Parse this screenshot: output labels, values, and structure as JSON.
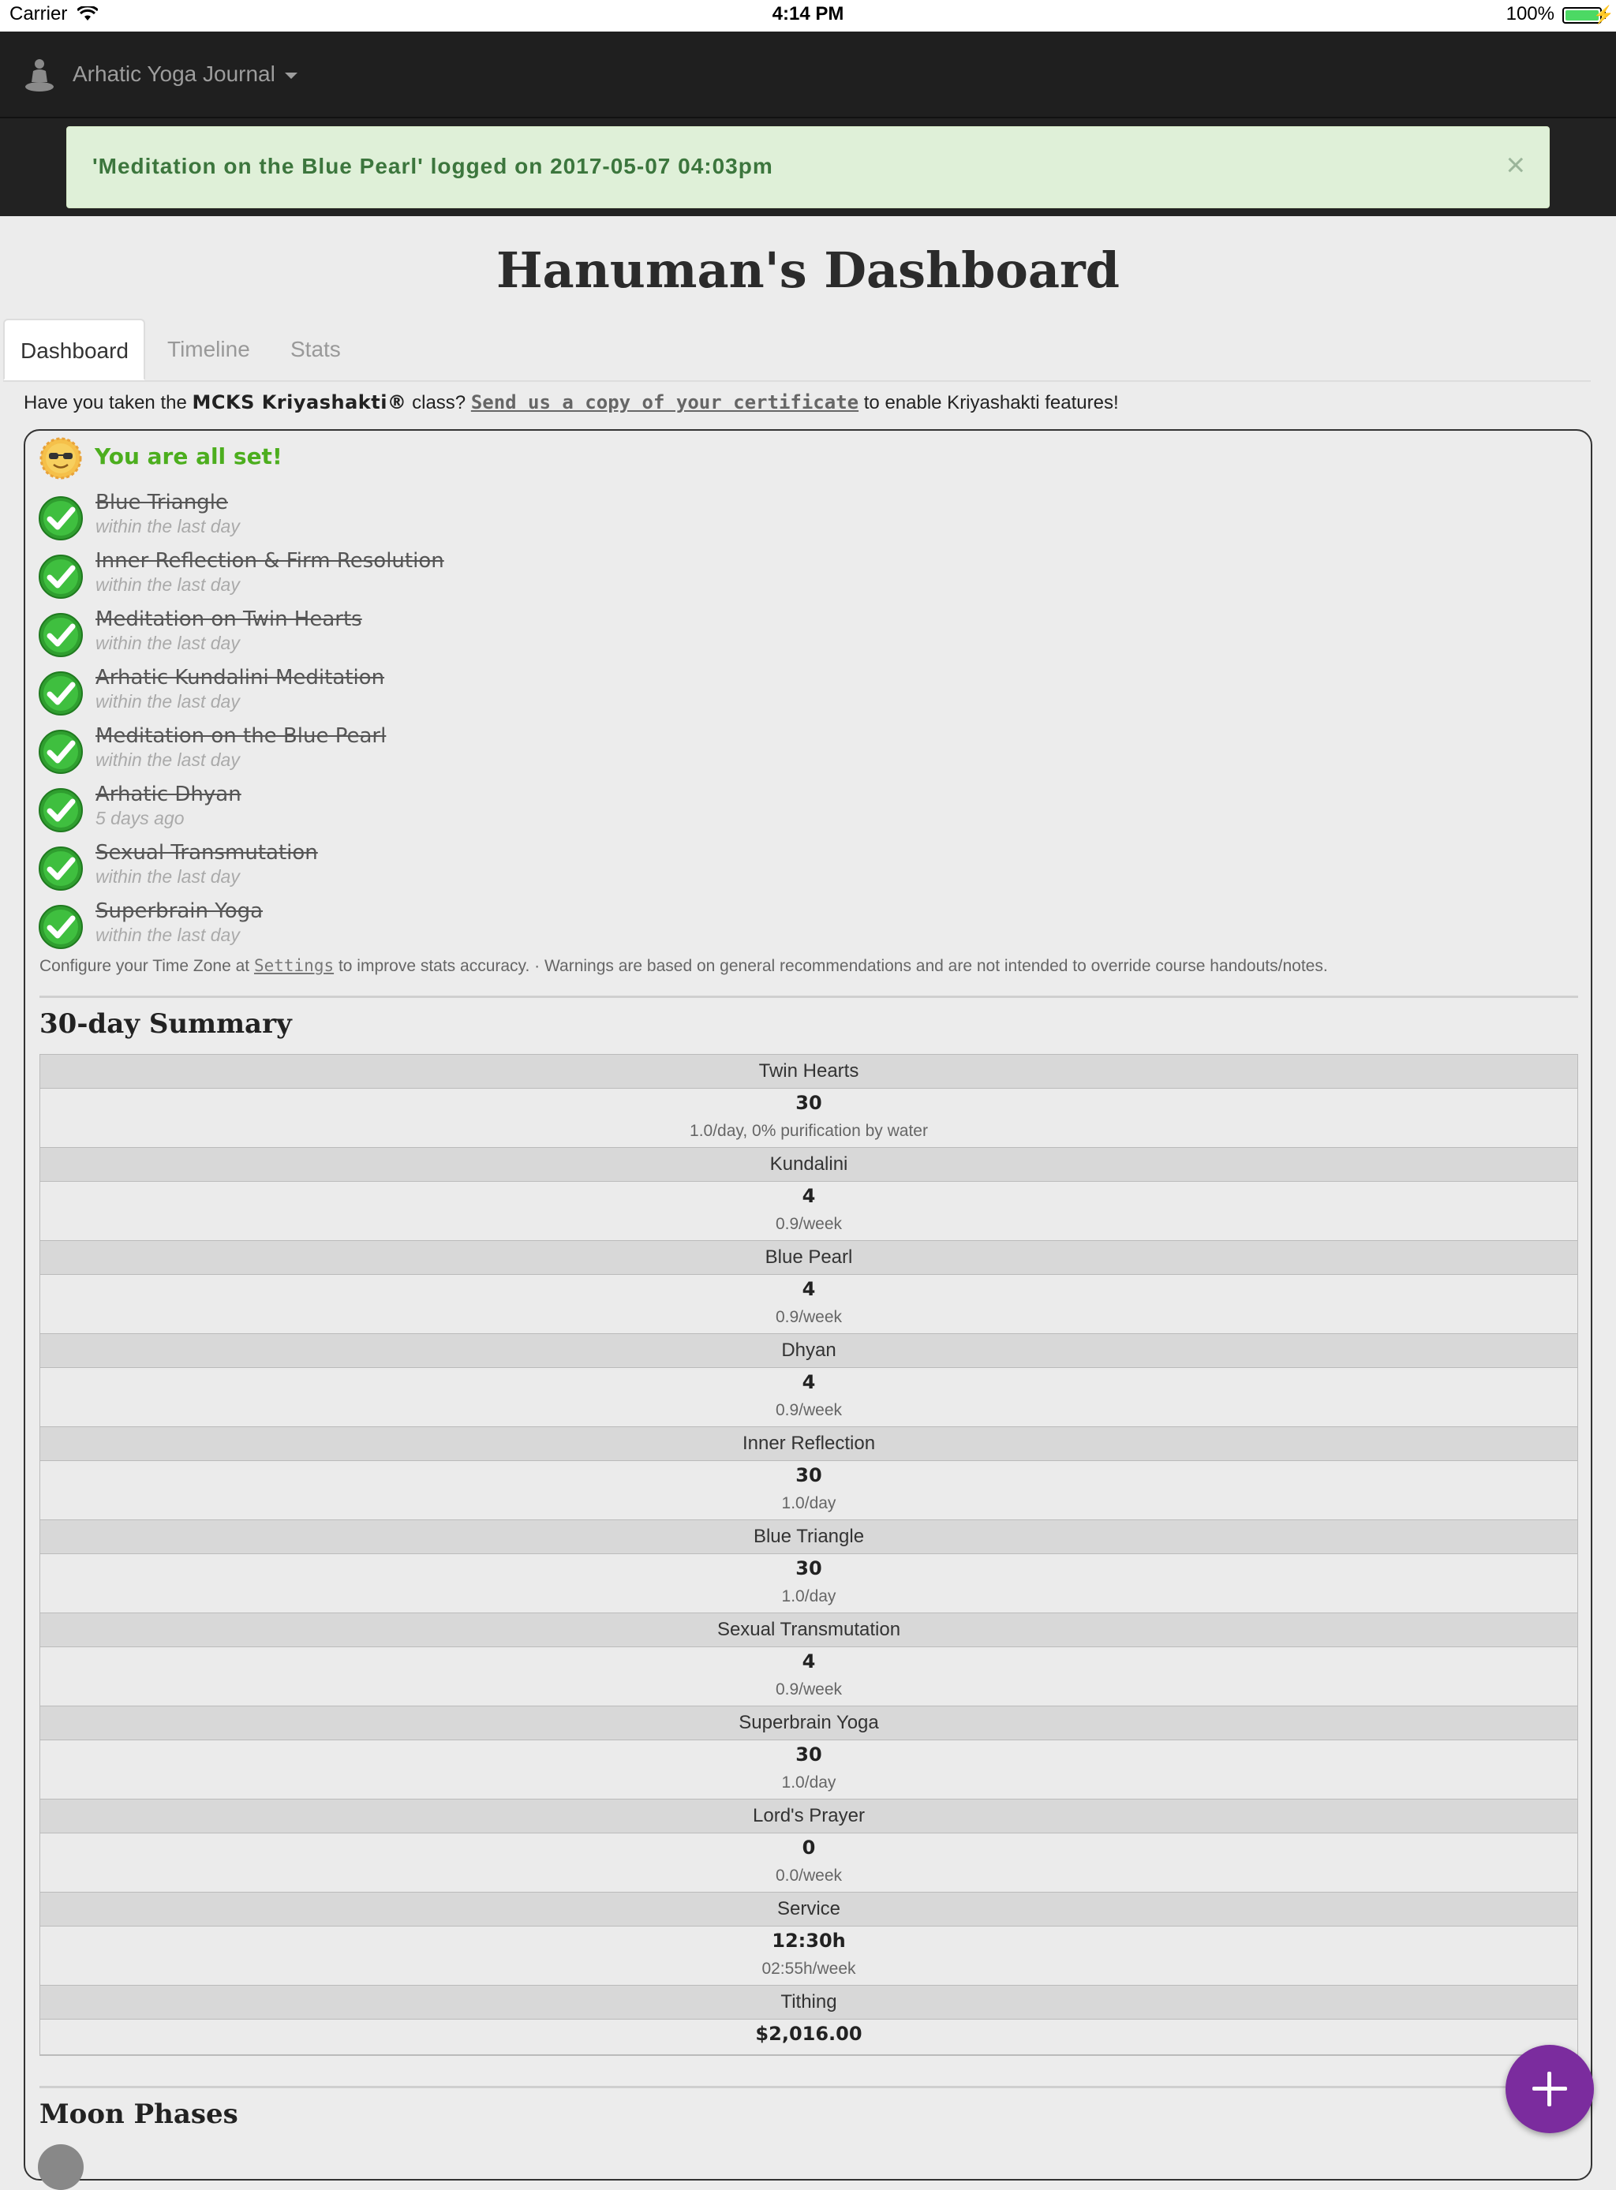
{
  "status_bar": {
    "carrier": "Carrier",
    "time": "4:14 PM",
    "battery": "100%"
  },
  "navbar": {
    "title": "Arhatic Yoga Journal"
  },
  "alert": {
    "message": "'Meditation on the Blue Pearl' logged on 2017-05-07 04:03pm",
    "close": "×"
  },
  "page_title": "Hanuman's Dashboard",
  "tabs": [
    {
      "label": "Dashboard",
      "active": true
    },
    {
      "label": "Timeline",
      "active": false
    },
    {
      "label": "Stats",
      "active": false
    }
  ],
  "cert": {
    "prefix": "Have you taken the ",
    "course": "MCKS Kriyashakti®",
    "mid": " class? ",
    "link": "Send us a copy of your certificate",
    "suffix": " to enable Kriyashakti features!"
  },
  "status_title": "You are all set!",
  "checklist": [
    {
      "name": "Blue Triangle",
      "time": "within the last day"
    },
    {
      "name": "Inner Reflection & Firm Resolution",
      "time": "within the last day"
    },
    {
      "name": "Meditation on Twin Hearts",
      "time": "within the last day"
    },
    {
      "name": "Arhatic Kundalini Meditation",
      "time": "within the last day"
    },
    {
      "name": "Meditation on the Blue Pearl",
      "time": "within the last day"
    },
    {
      "name": "Arhatic Dhyan",
      "time": "5 days ago"
    },
    {
      "name": "Sexual Transmutation",
      "time": "within the last day"
    },
    {
      "name": "Superbrain Yoga",
      "time": "within the last day"
    }
  ],
  "note": {
    "prefix": "Configure your Time Zone at ",
    "link": "Settings",
    "suffix": " to improve stats accuracy. · Warnings are based on general recommendations and are not intended to override course handouts/notes."
  },
  "summary": {
    "title": "30-day Summary",
    "rows": [
      {
        "header": "Twin Hearts",
        "value": "30",
        "sub": "1.0/day, 0% purification by water"
      },
      {
        "header": "Kundalini",
        "value": "4",
        "sub": "0.9/week"
      },
      {
        "header": "Blue Pearl",
        "value": "4",
        "sub": "0.9/week"
      },
      {
        "header": "Dhyan",
        "value": "4",
        "sub": "0.9/week"
      },
      {
        "header": "Inner Reflection",
        "value": "30",
        "sub": "1.0/day"
      },
      {
        "header": "Blue Triangle",
        "value": "30",
        "sub": "1.0/day"
      },
      {
        "header": "Sexual Transmutation",
        "value": "4",
        "sub": "0.9/week"
      },
      {
        "header": "Superbrain Yoga",
        "value": "30",
        "sub": "1.0/day"
      },
      {
        "header": "Lord's Prayer",
        "value": "0",
        "sub": "0.0/week"
      },
      {
        "header": "Service",
        "value": "12:30h",
        "sub": "02:55h/week"
      },
      {
        "header": "Tithing",
        "value": "$2,016.00",
        "sub": ""
      }
    ]
  },
  "moon": {
    "title": "Moon Phases"
  },
  "colors": {
    "accent_green": "#4cae1e",
    "alert_bg": "#dff0d8",
    "alert_text": "#3c763d",
    "fab": "#7b2c9e",
    "navbar": "#1f1f1f"
  },
  "icons": {
    "navbar": "meditation-icon",
    "status": "sunglasses-sun-icon",
    "check": "green-checkmark-icon",
    "fab": "plus-icon"
  }
}
